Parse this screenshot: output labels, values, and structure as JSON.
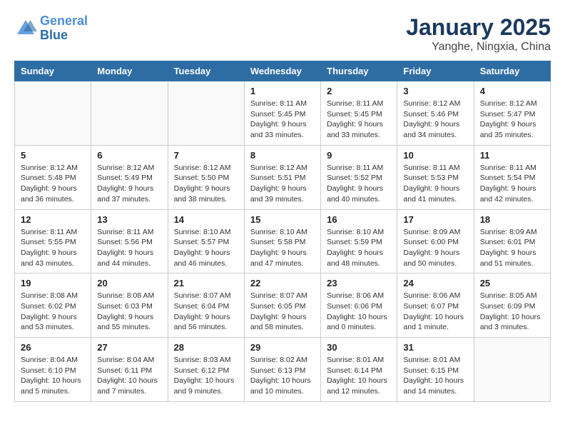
{
  "header": {
    "logo_line1": "General",
    "logo_line2": "Blue",
    "month": "January 2025",
    "location": "Yanghe, Ningxia, China"
  },
  "weekdays": [
    "Sunday",
    "Monday",
    "Tuesday",
    "Wednesday",
    "Thursday",
    "Friday",
    "Saturday"
  ],
  "weeks": [
    [
      {
        "day": "",
        "info": ""
      },
      {
        "day": "",
        "info": ""
      },
      {
        "day": "",
        "info": ""
      },
      {
        "day": "1",
        "info": "Sunrise: 8:11 AM\nSunset: 5:45 PM\nDaylight: 9 hours\nand 33 minutes."
      },
      {
        "day": "2",
        "info": "Sunrise: 8:11 AM\nSunset: 5:45 PM\nDaylight: 9 hours\nand 33 minutes."
      },
      {
        "day": "3",
        "info": "Sunrise: 8:12 AM\nSunset: 5:46 PM\nDaylight: 9 hours\nand 34 minutes."
      },
      {
        "day": "4",
        "info": "Sunrise: 8:12 AM\nSunset: 5:47 PM\nDaylight: 9 hours\nand 35 minutes."
      }
    ],
    [
      {
        "day": "5",
        "info": "Sunrise: 8:12 AM\nSunset: 5:48 PM\nDaylight: 9 hours\nand 36 minutes."
      },
      {
        "day": "6",
        "info": "Sunrise: 8:12 AM\nSunset: 5:49 PM\nDaylight: 9 hours\nand 37 minutes."
      },
      {
        "day": "7",
        "info": "Sunrise: 8:12 AM\nSunset: 5:50 PM\nDaylight: 9 hours\nand 38 minutes."
      },
      {
        "day": "8",
        "info": "Sunrise: 8:12 AM\nSunset: 5:51 PM\nDaylight: 9 hours\nand 39 minutes."
      },
      {
        "day": "9",
        "info": "Sunrise: 8:11 AM\nSunset: 5:52 PM\nDaylight: 9 hours\nand 40 minutes."
      },
      {
        "day": "10",
        "info": "Sunrise: 8:11 AM\nSunset: 5:53 PM\nDaylight: 9 hours\nand 41 minutes."
      },
      {
        "day": "11",
        "info": "Sunrise: 8:11 AM\nSunset: 5:54 PM\nDaylight: 9 hours\nand 42 minutes."
      }
    ],
    [
      {
        "day": "12",
        "info": "Sunrise: 8:11 AM\nSunset: 5:55 PM\nDaylight: 9 hours\nand 43 minutes."
      },
      {
        "day": "13",
        "info": "Sunrise: 8:11 AM\nSunset: 5:56 PM\nDaylight: 9 hours\nand 44 minutes."
      },
      {
        "day": "14",
        "info": "Sunrise: 8:10 AM\nSunset: 5:57 PM\nDaylight: 9 hours\nand 46 minutes."
      },
      {
        "day": "15",
        "info": "Sunrise: 8:10 AM\nSunset: 5:58 PM\nDaylight: 9 hours\nand 47 minutes."
      },
      {
        "day": "16",
        "info": "Sunrise: 8:10 AM\nSunset: 5:59 PM\nDaylight: 9 hours\nand 48 minutes."
      },
      {
        "day": "17",
        "info": "Sunrise: 8:09 AM\nSunset: 6:00 PM\nDaylight: 9 hours\nand 50 minutes."
      },
      {
        "day": "18",
        "info": "Sunrise: 8:09 AM\nSunset: 6:01 PM\nDaylight: 9 hours\nand 51 minutes."
      }
    ],
    [
      {
        "day": "19",
        "info": "Sunrise: 8:08 AM\nSunset: 6:02 PM\nDaylight: 9 hours\nand 53 minutes."
      },
      {
        "day": "20",
        "info": "Sunrise: 8:08 AM\nSunset: 6:03 PM\nDaylight: 9 hours\nand 55 minutes."
      },
      {
        "day": "21",
        "info": "Sunrise: 8:07 AM\nSunset: 6:04 PM\nDaylight: 9 hours\nand 56 minutes."
      },
      {
        "day": "22",
        "info": "Sunrise: 8:07 AM\nSunset: 6:05 PM\nDaylight: 9 hours\nand 58 minutes."
      },
      {
        "day": "23",
        "info": "Sunrise: 8:06 AM\nSunset: 6:06 PM\nDaylight: 10 hours\nand 0 minutes."
      },
      {
        "day": "24",
        "info": "Sunrise: 8:06 AM\nSunset: 6:07 PM\nDaylight: 10 hours\nand 1 minute."
      },
      {
        "day": "25",
        "info": "Sunrise: 8:05 AM\nSunset: 6:09 PM\nDaylight: 10 hours\nand 3 minutes."
      }
    ],
    [
      {
        "day": "26",
        "info": "Sunrise: 8:04 AM\nSunset: 6:10 PM\nDaylight: 10 hours\nand 5 minutes."
      },
      {
        "day": "27",
        "info": "Sunrise: 8:04 AM\nSunset: 6:11 PM\nDaylight: 10 hours\nand 7 minutes."
      },
      {
        "day": "28",
        "info": "Sunrise: 8:03 AM\nSunset: 6:12 PM\nDaylight: 10 hours\nand 9 minutes."
      },
      {
        "day": "29",
        "info": "Sunrise: 8:02 AM\nSunset: 6:13 PM\nDaylight: 10 hours\nand 10 minutes."
      },
      {
        "day": "30",
        "info": "Sunrise: 8:01 AM\nSunset: 6:14 PM\nDaylight: 10 hours\nand 12 minutes."
      },
      {
        "day": "31",
        "info": "Sunrise: 8:01 AM\nSunset: 6:15 PM\nDaylight: 10 hours\nand 14 minutes."
      },
      {
        "day": "",
        "info": ""
      }
    ]
  ]
}
